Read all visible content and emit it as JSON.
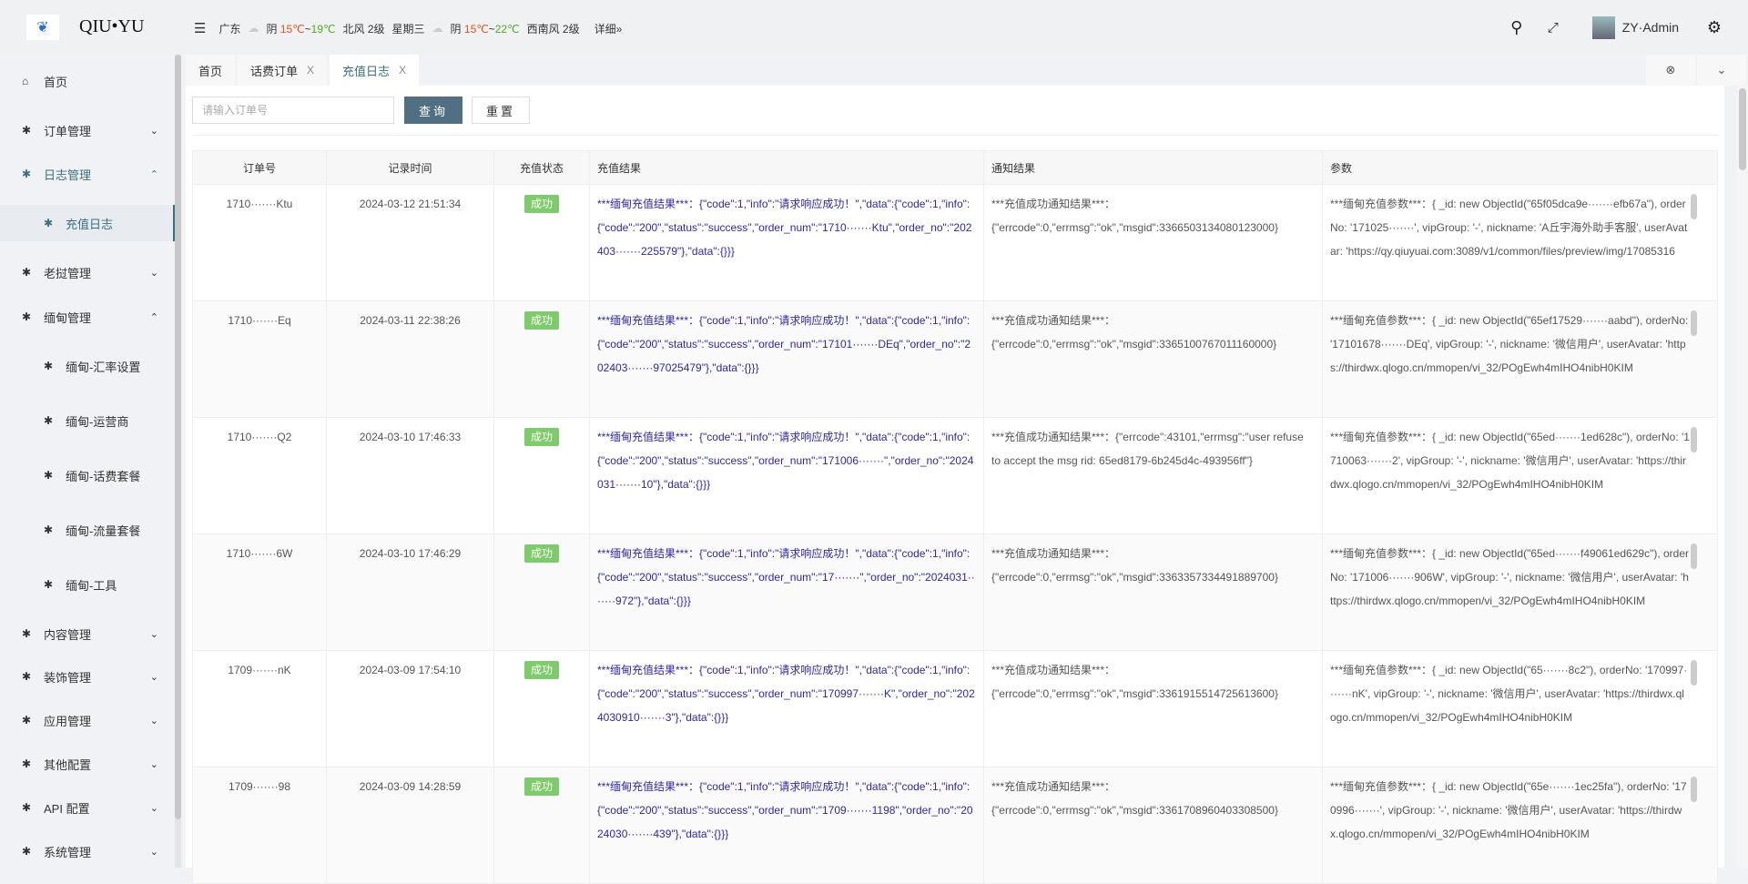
{
  "header": {
    "brand": "QIU•YU",
    "weather": {
      "city": "广东",
      "today": {
        "cond": "阴",
        "low": "15℃",
        "sep": "~",
        "high": "19℃",
        "wind": "北风 2级",
        "weekday": "星期三"
      },
      "tomorrow": {
        "cond": "阴",
        "low": "15℃",
        "sep": "~",
        "high": "22℃",
        "wind": "西南风 2级"
      },
      "detail": "详细»"
    },
    "user": "ZY·Admin"
  },
  "sidebar": {
    "items": [
      {
        "label": "首页"
      },
      {
        "label": "订单管理"
      },
      {
        "label": "日志管理"
      },
      {
        "label": "充值日志"
      },
      {
        "label": "老挝管理"
      },
      {
        "label": "缅甸管理"
      },
      {
        "label": "缅甸-汇率设置"
      },
      {
        "label": "缅甸-运营商"
      },
      {
        "label": "缅甸-话费套餐"
      },
      {
        "label": "缅甸-流量套餐"
      },
      {
        "label": "缅甸-工具"
      },
      {
        "label": "内容管理"
      },
      {
        "label": "装饰管理"
      },
      {
        "label": "应用管理"
      },
      {
        "label": "其他配置"
      },
      {
        "label": "API 配置"
      },
      {
        "label": "系统管理"
      }
    ]
  },
  "tabs": [
    {
      "label": "首页"
    },
    {
      "label": "话费订单",
      "close": "X"
    },
    {
      "label": "充值日志",
      "close": "X"
    }
  ],
  "toolbar": {
    "placeholder": "请输入订单号",
    "query": "查询",
    "reset": "重置"
  },
  "table": {
    "headers": [
      "订单号",
      "记录时间",
      "充值状态",
      "充值结果",
      "通知结果",
      "参数"
    ],
    "rows": [
      {
        "order": "1710·······Ktu",
        "time": "2024-03-12 21:51:34",
        "status": "成功",
        "result": "***缅甸充值结果***：{\"code\":1,\"info\":\"请求响应成功！\",\"data\":{\"code\":1,\"info\":{\"code\":\"200\",\"status\":\"success\",\"order_num\":\"1710·······Ktu\",\"order_no\":\"202403·······225579\"},\"data\":{}}}",
        "notify": "***充值成功通知结果***：{\"errcode\":0,\"errmsg\":\"ok\",\"msgid\":3366503134080123000}",
        "params": "***缅甸充值参数***：{ _id: new ObjectId(\"65f05dca9e·······efb67a\"), orderNo: '171025·······', vipGroup: '-', nickname: 'A丘宇海外助手客服', userAvatar: 'https://qy.qiuyuai.com:3089/v1/common/files/preview/img/17085316"
      },
      {
        "order": "1710·······Eq",
        "time": "2024-03-11 22:38:26",
        "status": "成功",
        "result": "***缅甸充值结果***：{\"code\":1,\"info\":\"请求响应成功！\",\"data\":{\"code\":1,\"info\":{\"code\":\"200\",\"status\":\"success\",\"order_num\":\"17101·······DEq\",\"order_no\":\"202403·······97025479\"},\"data\":{}}}",
        "notify": "***充值成功通知结果***：{\"errcode\":0,\"errmsg\":\"ok\",\"msgid\":3365100767011160000}",
        "params": "***缅甸充值参数***：{ _id: new ObjectId(\"65ef17529·······aabd\"), orderNo: '17101678·······DEq', vipGroup: '-', nickname: '微信用户', userAvatar: 'https://thirdwx.qlogo.cn/mmopen/vi_32/POgEwh4mIHO4nibH0KIM"
      },
      {
        "order": "1710·······Q2",
        "time": "2024-03-10 17:46:33",
        "status": "成功",
        "result": "***缅甸充值结果***：{\"code\":1,\"info\":\"请求响应成功！\",\"data\":{\"code\":1,\"info\":{\"code\":\"200\",\"status\":\"success\",\"order_num\":\"171006·······\",\"order_no\":\"2024031·······10\"},\"data\":{}}}",
        "notify": "***充值成功通知结果***：{\"errcode\":43101,\"errmsg\":\"user refuse to accept the msg rid: 65ed8179-6b245d4c-493956ff\"}",
        "params": "***缅甸充值参数***：{ _id: new ObjectId(\"65ed·······1ed628c\"), orderNo: '1710063·······2', vipGroup: '-', nickname: '微信用户', userAvatar: 'https://thirdwx.qlogo.cn/mmopen/vi_32/POgEwh4mIHO4nibH0KIM"
      },
      {
        "order": "1710·······6W",
        "time": "2024-03-10 17:46:29",
        "status": "成功",
        "result": "***缅甸充值结果***：{\"code\":1,\"info\":\"请求响应成功！\",\"data\":{\"code\":1,\"info\":{\"code\":\"200\",\"status\":\"success\",\"order_num\":\"17·······\",\"order_no\":\"2024031·······972\"},\"data\":{}}}",
        "notify": "***充值成功通知结果***：{\"errcode\":0,\"errmsg\":\"ok\",\"msgid\":3363357334491889700}",
        "params": "***缅甸充值参数***：{ _id: new ObjectId(\"65ed·······f49061ed629c\"), orderNo: '171006·······906W', vipGroup: '-', nickname: '微信用户', userAvatar: 'https://thirdwx.qlogo.cn/mmopen/vi_32/POgEwh4mIHO4nibH0KIM"
      },
      {
        "order": "1709·······nK",
        "time": "2024-03-09 17:54:10",
        "status": "成功",
        "result": "***缅甸充值结果***：{\"code\":1,\"info\":\"请求响应成功！\",\"data\":{\"code\":1,\"info\":{\"code\":\"200\",\"status\":\"success\",\"order_num\":\"170997·······K\",\"order_no\":\"2024030910·······3\"},\"data\":{}}}",
        "notify": "***充值成功通知结果***：{\"errcode\":0,\"errmsg\":\"ok\",\"msgid\":3361915514725613600}",
        "params": "***缅甸充值参数***：{ _id: new ObjectId(\"65·······8c2\"), orderNo: '170997·······nK', vipGroup: '-', nickname: '微信用户', userAvatar: 'https://thirdwx.qlogo.cn/mmopen/vi_32/POgEwh4mIHO4nibH0KIM"
      },
      {
        "order": "1709·······98",
        "time": "2024-03-09 14:28:59",
        "status": "成功",
        "result": "***缅甸充值结果***：{\"code\":1,\"info\":\"请求响应成功！\",\"data\":{\"code\":1,\"info\":{\"code\":\"200\",\"status\":\"success\",\"order_num\":\"1709·······1198\",\"order_no\":\"2024030·······439\"},\"data\":{}}}",
        "notify": "***充值成功通知结果***：{\"errcode\":0,\"errmsg\":\"ok\",\"msgid\":3361708960403308500}",
        "params": "***缅甸充值参数***：{ _id: new ObjectId(\"65e·······1ec25fa\"), orderNo: '170996·······', vipGroup: '-', nickname: '微信用户', userAvatar: 'https://thirdwx.qlogo.cn/mmopen/vi_32/POgEwh4mIHO4nibH0KIM"
      }
    ]
  },
  "colors": {
    "accent": "#3a6f80",
    "success": "#7dcb6b",
    "result_text": "#2f27a6"
  }
}
